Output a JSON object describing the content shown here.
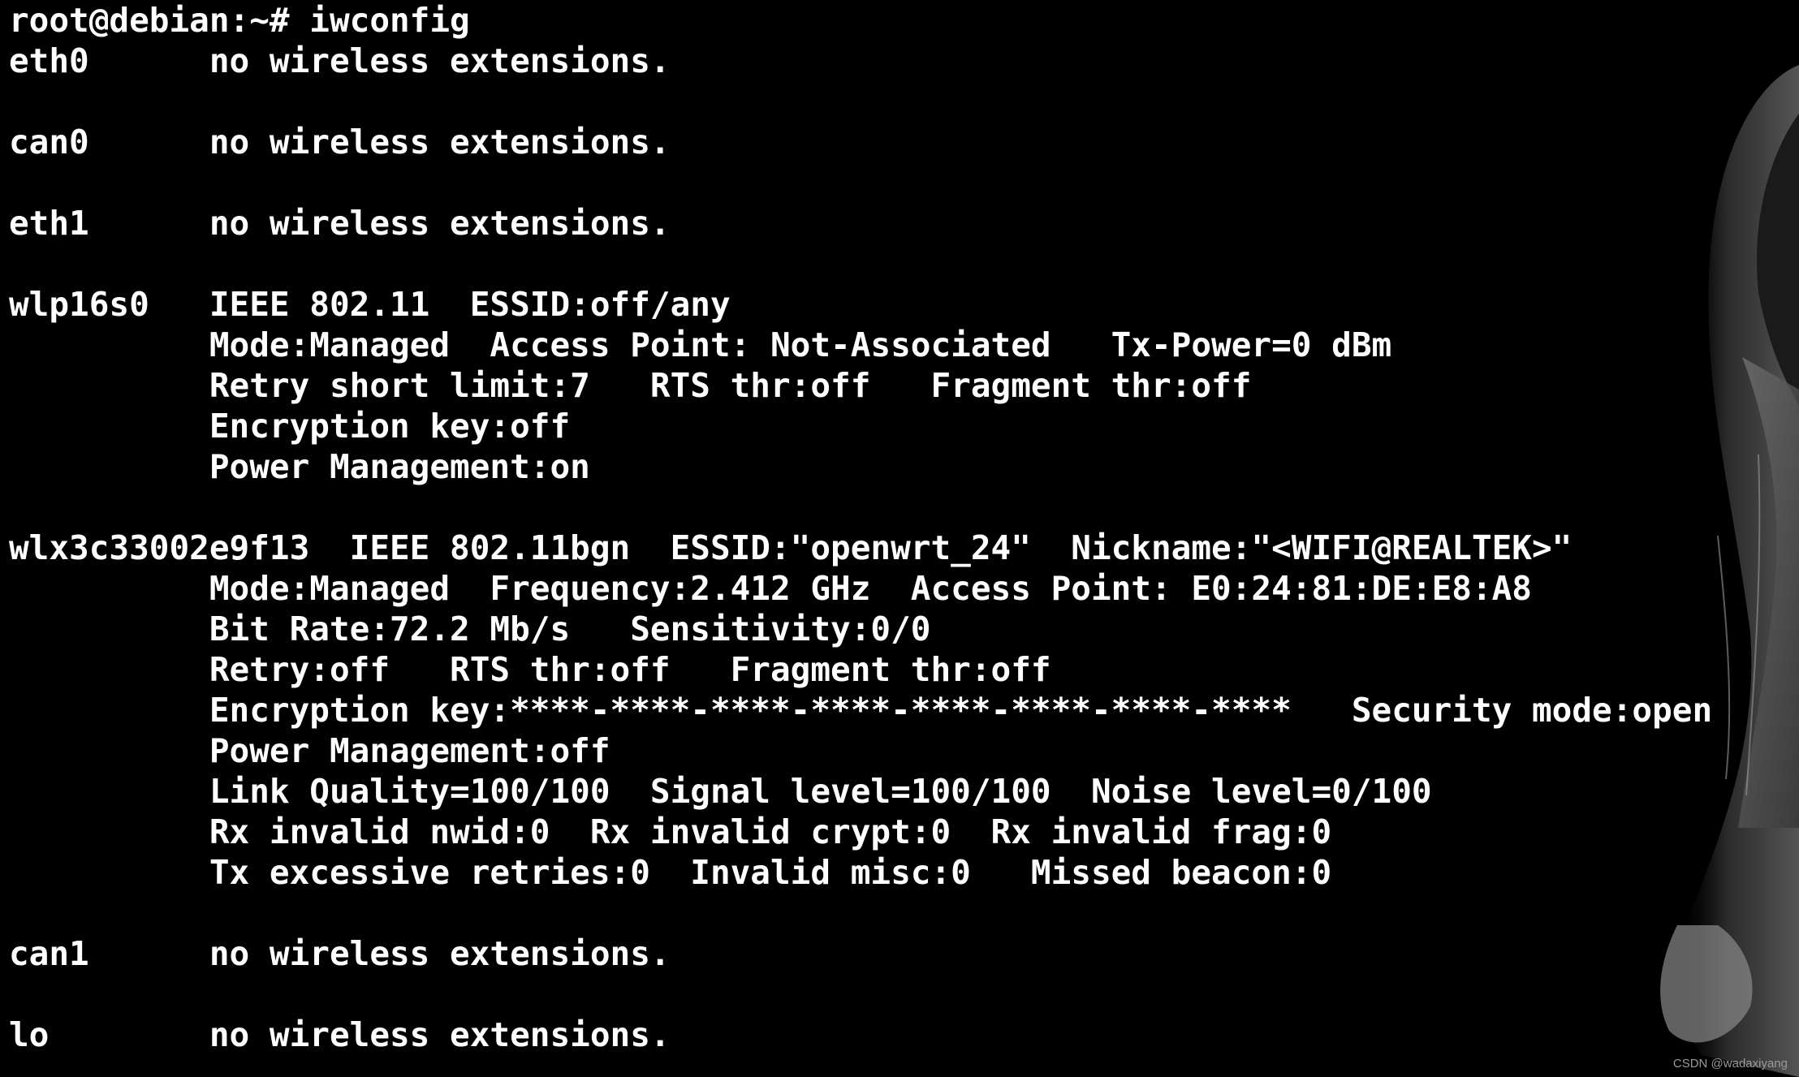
{
  "terminal": {
    "colors": {
      "background": "#000000",
      "text": "#ffffff"
    },
    "prompt": "root@debian:~# ",
    "command": "iwconfig",
    "output_lines": [
      "eth0      no wireless extensions.",
      "",
      "can0      no wireless extensions.",
      "",
      "eth1      no wireless extensions.",
      "",
      "wlp16s0   IEEE 802.11  ESSID:off/any",
      "          Mode:Managed  Access Point: Not-Associated   Tx-Power=0 dBm",
      "          Retry short limit:7   RTS thr:off   Fragment thr:off",
      "          Encryption key:off",
      "          Power Management:on",
      "",
      "wlx3c33002e9f13  IEEE 802.11bgn  ESSID:\"openwrt_24\"  Nickname:\"<WIFI@REALTEK>\"",
      "          Mode:Managed  Frequency:2.412 GHz  Access Point: E0:24:81:DE:E8:A8",
      "          Bit Rate:72.2 Mb/s   Sensitivity:0/0",
      "          Retry:off   RTS thr:off   Fragment thr:off",
      "          Encryption key:****-****-****-****-****-****-****-****   Security mode:open",
      "          Power Management:off",
      "          Link Quality=100/100  Signal level=100/100  Noise level=0/100",
      "          Rx invalid nwid:0  Rx invalid crypt:0  Rx invalid frag:0",
      "          Tx excessive retries:0  Invalid misc:0   Missed beacon:0",
      "",
      "can1      no wireless extensions.",
      "",
      "lo        no wireless extensions."
    ]
  },
  "watermark": "CSDN @wadaxiyang"
}
